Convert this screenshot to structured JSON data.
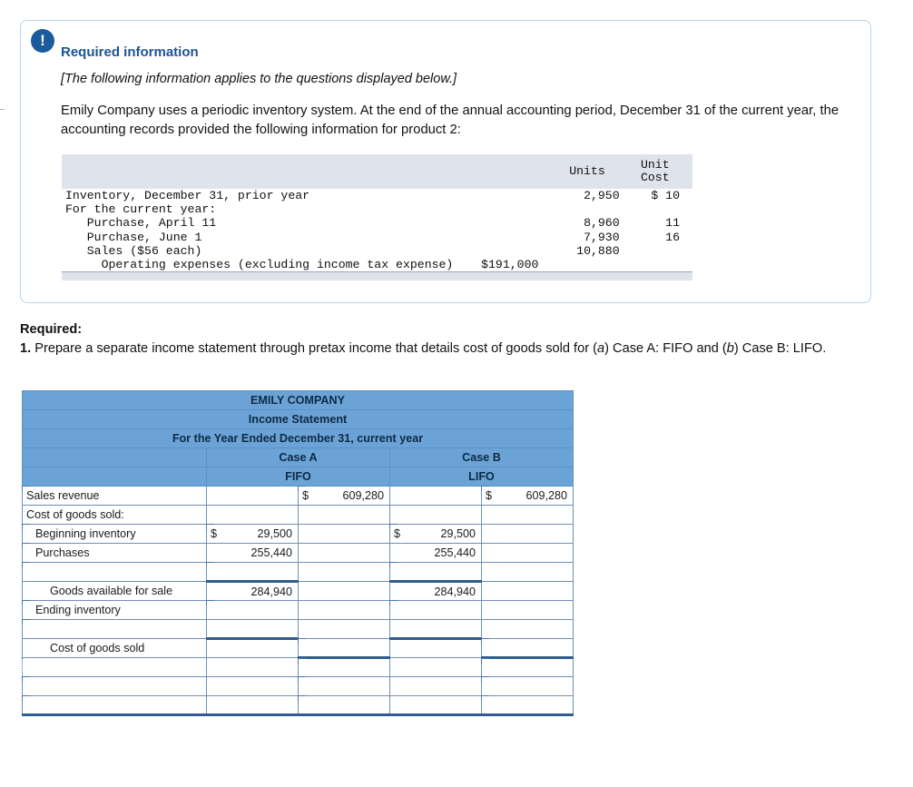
{
  "panel": {
    "badge": "!",
    "title": "Required information",
    "subtitle": "[The following information applies to the questions displayed below.]",
    "body": "Emily Company uses a periodic inventory system. At the end of the annual accounting period, December 31 of the current year, the accounting records provided the following information for product 2:",
    "table": {
      "headers": [
        "",
        "Units",
        "Unit\nCost"
      ],
      "header_units": "Units",
      "header_unit": "Unit",
      "header_cost": "Cost",
      "rows": [
        {
          "label": "Inventory, December 31, prior year",
          "mid": "",
          "units": "2,950",
          "cost": "$ 10"
        },
        {
          "label": "For the current year:",
          "mid": "",
          "units": "",
          "cost": ""
        },
        {
          "label": "   Purchase, April 11",
          "mid": "",
          "units": "8,960",
          "cost": "11"
        },
        {
          "label": "   Purchase, June 1",
          "mid": "",
          "units": "7,930",
          "cost": "16"
        },
        {
          "label": "   Sales ($56 each)",
          "mid": "",
          "units": "10,880",
          "cost": ""
        },
        {
          "label": "     Operating expenses (excluding income tax expense)",
          "mid": "$191,000",
          "units": "",
          "cost": ""
        }
      ]
    }
  },
  "required": {
    "heading": "Required:",
    "item_number": "1.",
    "text_1": "Prepare a separate income statement through pretax income that details cost of goods sold for (",
    "a": "a",
    "text_2": ") Case A: FIFO and (",
    "b": "b",
    "text_3": ") Case B: LIFO."
  },
  "statement": {
    "company": "EMILY COMPANY",
    "title": "Income Statement",
    "period": "For the Year Ended December 31, current year",
    "case_a": "Case A",
    "case_b": "Case B",
    "method_a": "FIFO",
    "method_b": "LIFO",
    "rows": [
      {
        "label": "Sales revenue",
        "indent": 0,
        "a_sym": "",
        "a_val": "",
        "a2_sym": "$",
        "a2_val": "609,280",
        "b_sym": "",
        "b_val": "",
        "b2_sym": "$",
        "b2_val": "609,280"
      },
      {
        "label": "Cost of goods sold:",
        "indent": 0,
        "a_sym": "",
        "a_val": "",
        "a2_sym": "",
        "a2_val": "",
        "b_sym": "",
        "b_val": "",
        "b2_sym": "",
        "b2_val": ""
      },
      {
        "label": "Beginning inventory",
        "indent": 1,
        "a_sym": "$",
        "a_val": "29,500",
        "a2_sym": "",
        "a2_val": "",
        "b_sym": "$",
        "b_val": "29,500",
        "b2_sym": "",
        "b2_val": ""
      },
      {
        "label": "Purchases",
        "indent": 1,
        "a_sym": "",
        "a_val": "255,440",
        "a2_sym": "",
        "a2_val": "",
        "b_sym": "",
        "b_val": "255,440",
        "b2_sym": "",
        "b2_val": ""
      },
      {
        "label": "",
        "indent": 0,
        "a_sym": "",
        "a_val": "",
        "a2_sym": "",
        "a2_val": "",
        "b_sym": "",
        "b_val": "",
        "b2_sym": "",
        "b2_val": ""
      },
      {
        "label": "Goods available for sale",
        "indent": 2,
        "a_sym": "",
        "a_val": "284,940",
        "a2_sym": "",
        "a2_val": "",
        "b_sym": "",
        "b_val": "284,940",
        "b2_sym": "",
        "b2_val": ""
      },
      {
        "label": "Ending inventory",
        "indent": 1,
        "a_sym": "",
        "a_val": "",
        "a2_sym": "",
        "a2_val": "",
        "b_sym": "",
        "b_val": "",
        "b2_sym": "",
        "b2_val": ""
      },
      {
        "label": "",
        "indent": 0,
        "a_sym": "",
        "a_val": "",
        "a2_sym": "",
        "a2_val": "",
        "b_sym": "",
        "b_val": "",
        "b2_sym": "",
        "b2_val": ""
      },
      {
        "label": "Cost of goods sold",
        "indent": 2,
        "a_sym": "",
        "a_val": "",
        "a2_sym": "",
        "a2_val": "",
        "b_sym": "",
        "b_val": "",
        "b2_sym": "",
        "b2_val": ""
      },
      {
        "label": "",
        "indent": 0,
        "select": true,
        "a_sym": "",
        "a_val": "",
        "a2_sym": "",
        "a2_val": "",
        "b_sym": "",
        "b_val": "",
        "b2_sym": "",
        "b2_val": ""
      },
      {
        "label": "",
        "indent": 0,
        "a_sym": "",
        "a_val": "",
        "a2_sym": "",
        "a2_val": "",
        "b_sym": "",
        "b_val": "",
        "b2_sym": "",
        "b2_val": ""
      },
      {
        "label": "",
        "indent": 0,
        "a_sym": "",
        "a_val": "",
        "a2_sym": "",
        "a2_val": "",
        "b_sym": "",
        "b_val": "",
        "b2_sym": "",
        "b2_val": ""
      }
    ],
    "dropdown_icon": "chevron-down-icon"
  }
}
